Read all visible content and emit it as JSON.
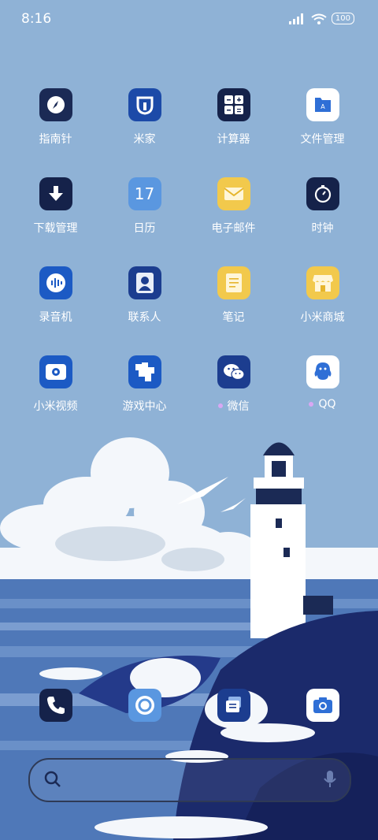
{
  "status_bar": {
    "time": "8:16",
    "battery": "100",
    "signal": "signal-icon",
    "wifi": "wifi-icon"
  },
  "apps": [
    {
      "label": "指南针",
      "icon": "compass-icon",
      "bg": "#1b2a55",
      "dot": false
    },
    {
      "label": "米家",
      "icon": "mijia-icon",
      "bg": "#1c4aa8",
      "dot": false
    },
    {
      "label": "计算器",
      "icon": "calculator-icon",
      "bg": "#15224a",
      "dot": false
    },
    {
      "label": "文件管理",
      "icon": "file-manager-icon",
      "bg": "#ffffff",
      "dot": false
    },
    {
      "label": "下载管理",
      "icon": "download-icon",
      "bg": "#15224a",
      "dot": false
    },
    {
      "label": "日历",
      "icon": "calendar-icon",
      "bg": "#5a97e0",
      "dot": false,
      "badge": "17"
    },
    {
      "label": "电子邮件",
      "icon": "mail-icon",
      "bg": "#f2c94c",
      "dot": false
    },
    {
      "label": "时钟",
      "icon": "clock-icon",
      "bg": "#15224a",
      "dot": false
    },
    {
      "label": "录音机",
      "icon": "recorder-icon",
      "bg": "#1c5ac4",
      "dot": false
    },
    {
      "label": "联系人",
      "icon": "contacts-icon",
      "bg": "#1c3d8f",
      "dot": false
    },
    {
      "label": "笔记",
      "icon": "notes-icon",
      "bg": "#f2c94c",
      "dot": false
    },
    {
      "label": "小米商城",
      "icon": "store-icon",
      "bg": "#f2c94c",
      "dot": false
    },
    {
      "label": "小米视频",
      "icon": "video-icon",
      "bg": "#1c5ac4",
      "dot": false
    },
    {
      "label": "游戏中心",
      "icon": "game-center-icon",
      "bg": "#1c5ac4",
      "dot": false
    },
    {
      "label": "微信",
      "icon": "wechat-icon",
      "bg": "#1c3d8f",
      "dot": true
    },
    {
      "label": "QQ",
      "icon": "qq-icon",
      "bg": "#ffffff",
      "dot": true
    }
  ],
  "dock": [
    {
      "name": "phone",
      "icon": "phone-icon",
      "bg": "#15224a"
    },
    {
      "name": "browser",
      "icon": "browser-icon",
      "bg": "#5a97e0"
    },
    {
      "name": "messages",
      "icon": "messages-icon",
      "bg": "#1c3d8f"
    },
    {
      "name": "camera",
      "icon": "camera-icon",
      "bg": "#ffffff"
    }
  ],
  "search_bar": {
    "search_icon": "search-icon",
    "mic_icon": "microphone-icon"
  },
  "colors": {
    "sky": "#8fb2d6",
    "sea": "#4f78b8",
    "rock": "#1b2a6b",
    "cloud": "#f4f7fb"
  }
}
